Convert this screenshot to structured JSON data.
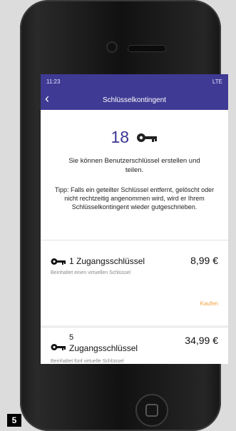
{
  "status": {
    "time": "11:23",
    "signal": "LTE"
  },
  "header": {
    "title": "Schlüsselkontingent"
  },
  "counter": {
    "value": "18"
  },
  "description": "Sie können Benutzerschlüssel erstellen und teilen.",
  "tip": "Tipp: Falls ein geteilter Schlüssel entfernt, gelöscht oder nicht rechtzeitig angenommen wird, wird er Ihrem Schlüsselkontingent wieder gutgeschrieben.",
  "products": [
    {
      "qty": "1",
      "name": "Zugangsschlüssel",
      "price": "8,99 €",
      "subtitle": "Beinhaltet einen virtuellen Schlüssel",
      "buy": "Kaufen"
    },
    {
      "qty": "5",
      "name": "Zugangsschlüssel",
      "price": "34,99 €",
      "subtitle": "Beinhaltet fünf virtuelle Schlüssel"
    }
  ],
  "badge": {
    "number": "5"
  },
  "icons": [
    "back-arrow-icon",
    "key-icon"
  ],
  "colors": {
    "appbar": "#3f3a94",
    "accent": "#f0a33a"
  }
}
